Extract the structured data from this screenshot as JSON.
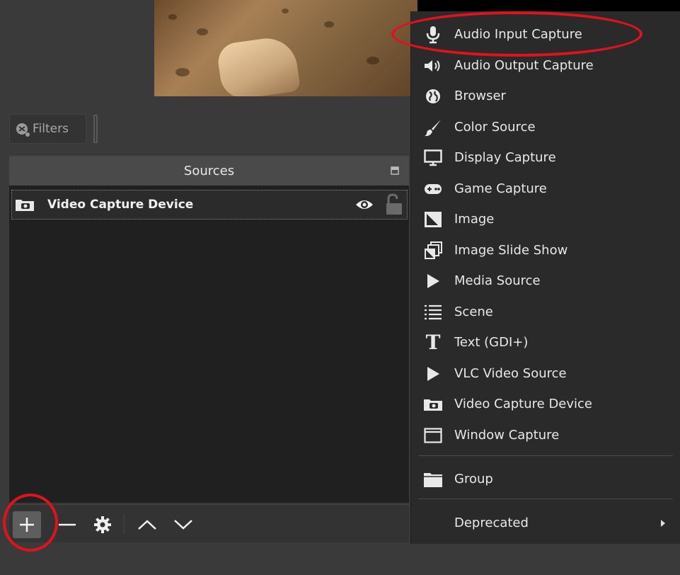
{
  "filters": {
    "label": "Filters"
  },
  "sources": {
    "title": "Sources",
    "items": [
      {
        "label": "Video Capture Device"
      }
    ]
  },
  "menu": {
    "items": [
      {
        "label": "Audio Input Capture",
        "icon": "microphone-icon"
      },
      {
        "label": "Audio Output Capture",
        "icon": "speaker-icon"
      },
      {
        "label": "Browser",
        "icon": "globe-icon"
      },
      {
        "label": "Color Source",
        "icon": "brush-icon"
      },
      {
        "label": "Display Capture",
        "icon": "monitor-icon"
      },
      {
        "label": "Game Capture",
        "icon": "gamepad-icon"
      },
      {
        "label": "Image",
        "icon": "image-icon"
      },
      {
        "label": "Image Slide Show",
        "icon": "slideshow-icon"
      },
      {
        "label": "Media Source",
        "icon": "play-icon"
      },
      {
        "label": "Scene",
        "icon": "list-icon"
      },
      {
        "label": "Text (GDI+)",
        "icon": "text-icon"
      },
      {
        "label": "VLC Video Source",
        "icon": "play-icon"
      },
      {
        "label": "Video Capture Device",
        "icon": "camera-icon"
      },
      {
        "label": "Window Capture",
        "icon": "window-icon"
      }
    ],
    "group": {
      "label": "Group",
      "icon": "folder-icon"
    },
    "deprecated": {
      "label": "Deprecated"
    }
  },
  "colors": {
    "highlight": "#e0121e",
    "menu_bg": "#2a2a2a",
    "panel_bg": "#202020"
  }
}
